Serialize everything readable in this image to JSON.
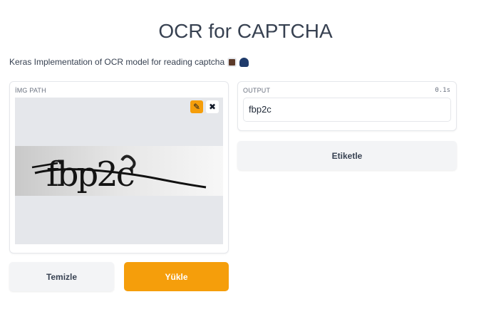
{
  "header": {
    "title": "OCR for CAPTCHA",
    "subtitle": "Keras Implementation of OCR model for reading captcha"
  },
  "input_panel": {
    "label": "İMG PATH",
    "captcha_text": "fbp2c",
    "edit_icon": "pencil-icon",
    "clear_icon": "close-icon"
  },
  "output_panel": {
    "label": "OUTPUT",
    "time": "0.1s",
    "value": "fbp2c"
  },
  "buttons": {
    "tag": "Etiketle",
    "clear": "Temizle",
    "upload": "Yükle"
  },
  "colors": {
    "accent": "#f59e0b",
    "secondary_bg": "#f3f4f6"
  }
}
